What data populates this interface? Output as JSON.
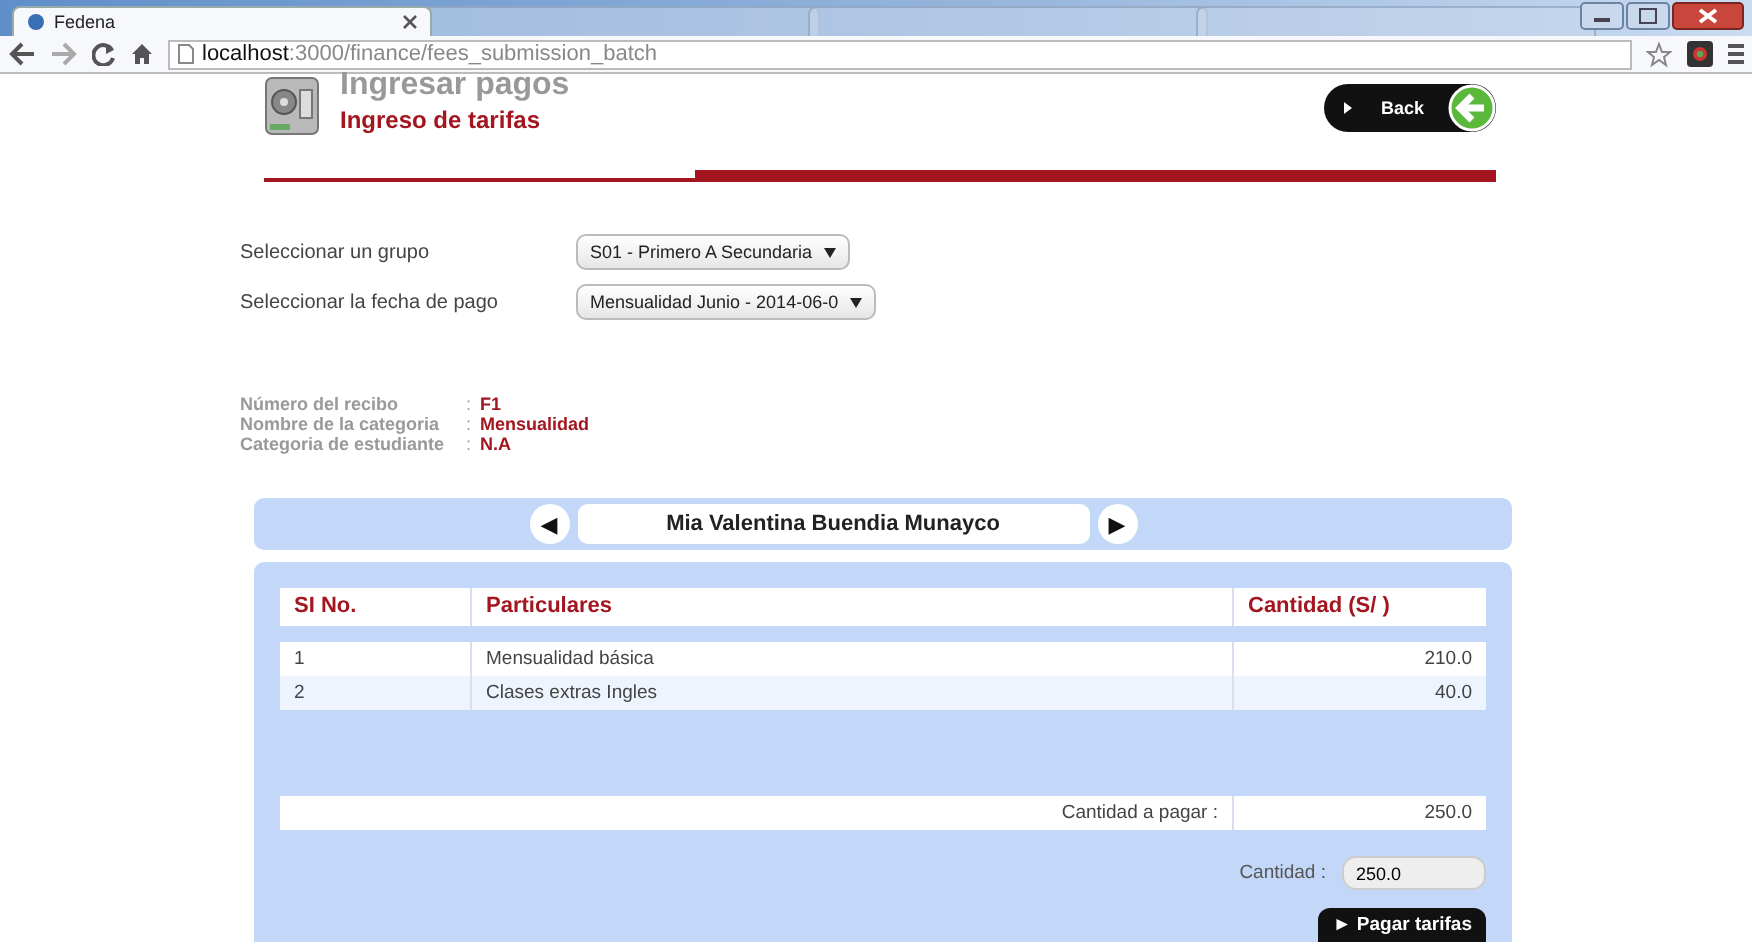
{
  "browser": {
    "tabs": [
      {
        "label": "Fedena",
        "selected": true
      },
      {
        "selected": false
      },
      {
        "selected": false
      },
      {
        "selected": false
      }
    ],
    "url_host": "localhost",
    "url_path": ":3000/finance/fees_submission_batch"
  },
  "header": {
    "title": "Ingresar pagos",
    "subtitle": "Ingreso de tarifas",
    "back_button": "Back"
  },
  "selects": [
    {
      "label": "Seleccionar un grupo",
      "value": "S01 - Primero A Secundaria"
    },
    {
      "label": "Seleccionar la fecha de pago",
      "value": "Mensualidad Junio - 2014-06-0"
    }
  ],
  "info": [
    {
      "label": "Número del recibo",
      "separator": ":",
      "value": "F1"
    },
    {
      "label": "Nombre de la categoria",
      "separator": ":",
      "value": "Mensualidad"
    },
    {
      "label": "Categoria de estudiante",
      "separator": ":",
      "value": "N.A"
    }
  ],
  "student_nav": {
    "prev": "◀",
    "name": "Mia Valentina Buendia Munayco",
    "next": "▶"
  },
  "table": {
    "columns": [
      "SI No.",
      "Particulares",
      "Cantidad (S/ )"
    ],
    "rows": [
      [
        "1",
        "Mensualidad básica",
        "210.0"
      ],
      [
        "2",
        "Clases extras Ingles",
        "40.0"
      ]
    ],
    "total_label": "Cantidad a pagar :",
    "total": "250.0"
  },
  "payment": {
    "label": "Cantidad :",
    "value": "250.0",
    "submit": "► Pagar tarifas"
  }
}
